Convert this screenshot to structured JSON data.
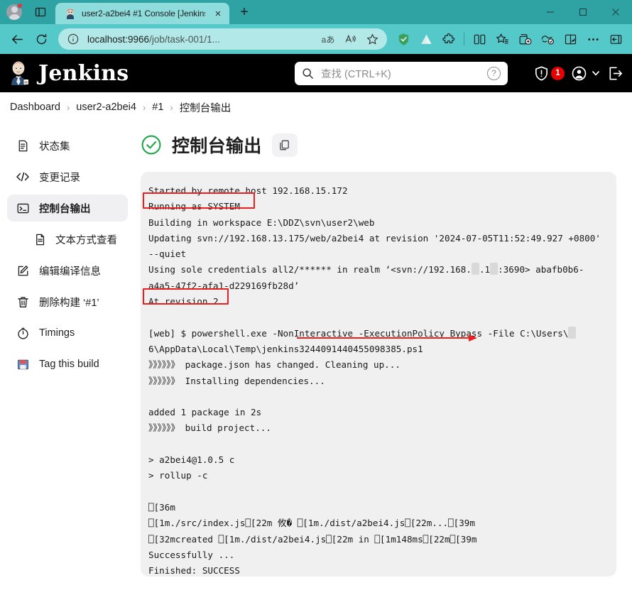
{
  "browser": {
    "tab": {
      "title": "user2-a2bei4 #1 Console [Jenkins",
      "favicon_name": "jenkins-favicon",
      "close_label": "×"
    },
    "newtab_label": "+",
    "omnibox": {
      "url_host": "localhost:9966",
      "url_path": "/job/task-001/1...",
      "info_icon": "info-icon",
      "translate_icon": "ああ",
      "read_aloud_icon": "read-aloud-icon",
      "favorite_icon": "star-icon"
    },
    "nav": {
      "back": "←",
      "reload": "↻"
    },
    "toolbar_icons": [
      "shield-check-icon",
      "delta-icon",
      "extensions-icon",
      "split-screen-icon",
      "collections-icon",
      "add-tab-group-icon",
      "copilot-icon",
      "browser-essentials-icon",
      "settings-more-icon",
      "sidebar-icon"
    ],
    "window_controls": {
      "minimize": "—",
      "maximize": "□",
      "close": "✕"
    }
  },
  "jenkins": {
    "brand": "Jenkins",
    "search": {
      "placeholder": "查找 (CTRL+K)",
      "icon": "search-icon",
      "help_icon": "help-icon"
    },
    "alert_count": "1",
    "alert_icon": "security-shield-icon",
    "user_icon": "user-account-icon",
    "user_chevron": "chevron-down-icon",
    "logout_icon": "logout-icon"
  },
  "breadcrumb": {
    "separator": "›",
    "items": [
      {
        "label": "Dashboard"
      },
      {
        "label": "user2-a2bei4"
      },
      {
        "label": "#1"
      },
      {
        "label": "控制台输出"
      }
    ]
  },
  "sidebar": {
    "items": [
      {
        "label": "状态集",
        "icon": "document-status-icon",
        "active": false,
        "sub": false
      },
      {
        "label": "变更记录",
        "icon": "code-brackets-icon",
        "active": false,
        "sub": false
      },
      {
        "label": "控制台输出",
        "icon": "terminal-icon",
        "active": true,
        "sub": false
      },
      {
        "label": "文本方式查看",
        "icon": "file-text-icon",
        "active": false,
        "sub": true
      },
      {
        "label": "编辑编译信息",
        "icon": "edit-square-icon",
        "active": false,
        "sub": false
      },
      {
        "label": "删除构建 ‘#1’",
        "icon": "trash-icon",
        "active": false,
        "sub": false
      },
      {
        "label": "Timings",
        "icon": "clock-icon",
        "active": false,
        "sub": false
      },
      {
        "label": "Tag this build",
        "icon": "floppy-save-icon",
        "active": false,
        "sub": false
      }
    ]
  },
  "main": {
    "status_icon": "success-check-circle-icon",
    "title": "控制台输出",
    "copy_icon": "copy-icon",
    "console_lines": [
      "Started by remote host 192.168.15.172",
      "Running as SYSTEM",
      "Building in workspace E:\\DDZ\\svn\\user2\\web",
      "Updating svn://192.168.13.175/web/a2bei4 at revision '2024-07-05T11:52:49.927 +0800' --quiet",
      "Using sole credentials all2/****** in realm ‘<svn://192.168.█.1█:3690> abafb0b6-a4a5-47f2-afa1-d229169fb28d’",
      "At revision 2",
      "",
      "[web] $ powershell.exe -NonInteractive -ExecutionPolicy Bypass -File C:\\Users\\█ 6\\AppData\\Local\\Temp\\jenkins3244091440455098385.ps1",
      "》》》》》》 package.json has changed. Cleaning up...",
      "》》》》》》 Installing dependencies...",
      "",
      "added 1 package in 2s",
      "》》》》》》 build project...",
      "",
      "> a2bei4@1.0.5 c",
      "> rollup -c",
      "",
      "⎕[36m",
      "⎕[1m./src/index.js⎕[22m 攸� ⎕[1m./dist/a2bei4.js⎕[22m...⎕[39m",
      "⎕[32mcreated ⎕[1m./dist/a2bei4.js⎕[22m in ⎕[1m148ms⎕[22m⎕[39m",
      "Successfully ...",
      "Finished: SUCCESS"
    ],
    "annotations": {
      "highlight_1": "Running as SYSTEM",
      "highlight_2": "At revision 2",
      "arrow_target": "jenkins3244091440455098385.ps1"
    }
  },
  "colors": {
    "browser_accent": "#55c9c9",
    "tabstrip": "#2fa3a3",
    "jenkins_header": "#000000",
    "success_green": "#1ea64a",
    "annotation_red": "#e8201f",
    "alert_red": "#e60000",
    "console_bg": "#f0f0f0"
  }
}
